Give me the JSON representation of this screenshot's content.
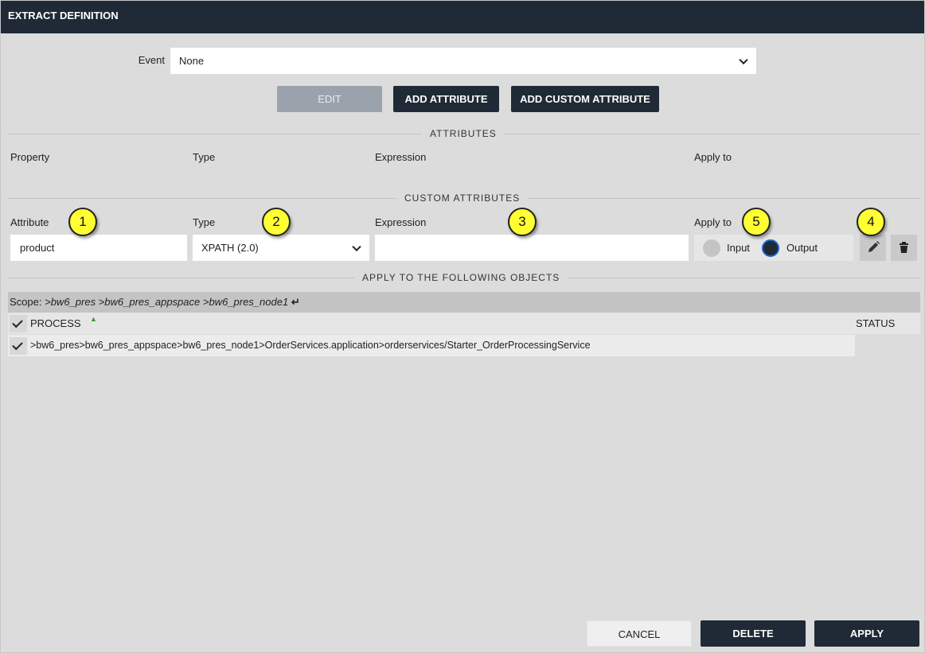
{
  "window": {
    "title": "EXTRACT DEFINITION"
  },
  "event": {
    "label": "Event",
    "value": "None"
  },
  "toolbar": {
    "edit_label": "EDIT",
    "add_attribute_label": "ADD ATTRIBUTE",
    "add_custom_attribute_label": "ADD CUSTOM ATTRIBUTE"
  },
  "attributes_section": {
    "title": "ATTRIBUTES",
    "columns": [
      "Property",
      "Type",
      "Expression",
      "Apply to"
    ]
  },
  "custom_attributes_section": {
    "title": "CUSTOM ATTRIBUTES",
    "columns": [
      "Attribute",
      "Type",
      "Expression",
      "Apply to"
    ],
    "row": {
      "attribute": "product",
      "type": "XPATH (2.0)",
      "expression": "",
      "apply_input_label": "Input",
      "apply_output_label": "Output",
      "apply_selected": "Output"
    }
  },
  "markers": [
    "1",
    "2",
    "3",
    "4",
    "5"
  ],
  "objects_section": {
    "title": "APPLY TO THE FOLLOWING OBJECTS",
    "scope_prefix": "Scope:",
    "scope_path": ">bw6_pres >bw6_pres_appspace >bw6_pres_node1",
    "enter_glyph": "↵",
    "table": {
      "header_process": "PROCESS",
      "header_status": "STATUS",
      "sort_glyph": "▲",
      "rows": [
        {
          "process": ">bw6_pres>bw6_pres_appspace>bw6_pres_node1>OrderServices.application>orderservices/Starter_OrderProcessingService",
          "status": ""
        }
      ]
    }
  },
  "footer": {
    "cancel_label": "CANCEL",
    "delete_label": "DELETE",
    "apply_label": "APPLY"
  },
  "colors": {
    "titlebar": "#1f2a36",
    "dark_button": "#1f2a36",
    "marker": "#ffff33",
    "radio_selected_ring": "#1e63c6",
    "sort_arrow": "#2e9e2e"
  },
  "icons": [
    "chevron-down-icon",
    "pencil-icon",
    "trash-icon",
    "check-icon",
    "sort-up-icon",
    "enter-icon"
  ]
}
